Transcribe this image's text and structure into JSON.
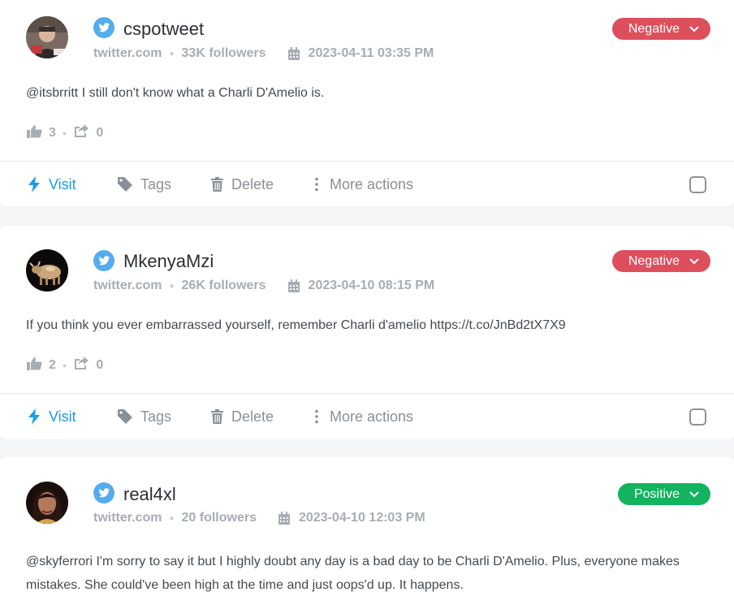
{
  "posts": [
    {
      "author": "cspotweet",
      "source": "twitter.com",
      "followers": "33K followers",
      "datetime": "2023-04-11 03:35 PM",
      "sentiment": "Negative",
      "text": "@itsbrritt I still don't know what a Charli D'Amelio is.",
      "likes": "3",
      "shares": "0"
    },
    {
      "author": "MkenyaMzi",
      "source": "twitter.com",
      "followers": "26K followers",
      "datetime": "2023-04-10 08:15 PM",
      "sentiment": "Negative",
      "text": "If you think you ever embarrassed yourself, remember Charli d'amelio https://t.co/JnBd2tX7X9",
      "likes": "2",
      "shares": "0"
    },
    {
      "author": "real4xl",
      "source": "twitter.com",
      "followers": "20 followers",
      "datetime": "2023-04-10 12:03 PM",
      "sentiment": "Positive",
      "text": "@skyferrori I'm sorry to say it but I highly doubt any day is a bad day to be Charli D'Amelio. Plus, everyone makes mistakes. She could've been high at the time and just oops'd up. It happens."
    }
  ],
  "actions": {
    "visit": "Visit",
    "tags": "Tags",
    "delete": "Delete",
    "more": "More actions"
  },
  "colors": {
    "negative": "#dd4f5c",
    "positive": "#13b35f",
    "twitter": "#55acee",
    "visit": "#1b9ae6"
  },
  "icons": [
    "twitter-icon",
    "calendar-icon",
    "thumbs-up-icon",
    "share-icon",
    "bolt-icon",
    "tag-icon",
    "trash-icon",
    "more-vertical-icon",
    "chevron-down-icon"
  ]
}
